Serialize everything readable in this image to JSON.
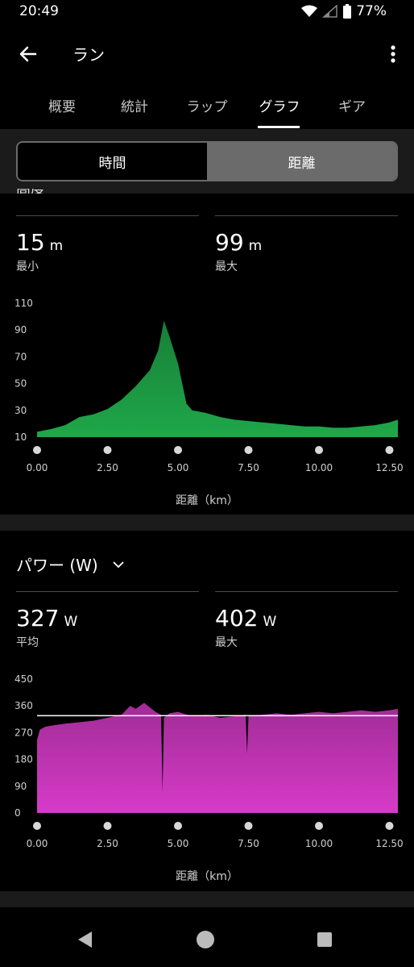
{
  "status": {
    "time": "20:49",
    "battery": "77%"
  },
  "appbar": {
    "title": "ラン"
  },
  "tabs": [
    {
      "label": "概要"
    },
    {
      "label": "統計"
    },
    {
      "label": "ラップ"
    },
    {
      "label": "グラフ"
    },
    {
      "label": "ギア"
    }
  ],
  "toggle": {
    "time_label": "時間",
    "distance_label": "距離"
  },
  "elevation": {
    "title_partial": "高度",
    "min_value": "15",
    "min_unit": "m",
    "min_label": "最小",
    "max_value": "99",
    "max_unit": "m",
    "max_label": "最大",
    "xaxis_title": "距離（km）",
    "color": "#1fa84a"
  },
  "power": {
    "title": "パワー (W)",
    "avg_value": "327",
    "avg_unit": "W",
    "avg_label": "平均",
    "max_value": "402",
    "max_unit": "W",
    "max_label": "最大",
    "xaxis_title": "距離（km）",
    "color": "#d63bc8"
  },
  "chart_data": [
    {
      "type": "area",
      "x": [
        0,
        0.5,
        1.0,
        1.5,
        2.0,
        2.5,
        3.0,
        3.5,
        4.0,
        4.3,
        4.5,
        4.7,
        5.0,
        5.3,
        5.5,
        6.0,
        6.5,
        7.0,
        7.5,
        8.0,
        8.5,
        9.0,
        9.5,
        10.0,
        10.5,
        11.0,
        11.5,
        12.0,
        12.5,
        12.8
      ],
      "y": [
        14,
        16,
        19,
        25,
        27,
        31,
        38,
        48,
        60,
        75,
        97,
        85,
        65,
        35,
        30,
        28,
        25,
        23,
        22,
        21,
        20,
        19,
        18,
        18,
        17,
        17,
        18,
        19,
        21,
        23
      ],
      "xlabel": "距離（km）",
      "ylabel": "",
      "xticks": [
        "0.00",
        "2.50",
        "5.00",
        "7.50",
        "10.00",
        "12.50"
      ],
      "yticks": [
        "10",
        "30",
        "50",
        "70",
        "90",
        "110"
      ],
      "xlim": [
        0,
        12.8
      ],
      "ylim": [
        10,
        110
      ]
    },
    {
      "type": "area",
      "x": [
        0,
        0.1,
        0.3,
        0.6,
        1.0,
        1.5,
        2.0,
        2.5,
        3.0,
        3.3,
        3.5,
        3.8,
        4.0,
        4.2,
        4.4,
        4.45,
        4.5,
        4.7,
        5.0,
        5.5,
        6.0,
        6.5,
        7.0,
        7.4,
        7.45,
        7.5,
        8.0,
        8.5,
        9.0,
        9.5,
        10.0,
        10.5,
        11.0,
        11.5,
        12.0,
        12.5,
        12.8
      ],
      "y": [
        245,
        280,
        290,
        295,
        300,
        305,
        310,
        320,
        330,
        360,
        350,
        370,
        355,
        340,
        330,
        70,
        320,
        335,
        340,
        325,
        330,
        320,
        325,
        330,
        200,
        325,
        330,
        335,
        330,
        335,
        340,
        335,
        340,
        345,
        340,
        345,
        350
      ],
      "avg_line": 327,
      "xlabel": "距離（km）",
      "ylabel": "",
      "xticks": [
        "0.00",
        "2.50",
        "5.00",
        "7.50",
        "10.00",
        "12.50"
      ],
      "yticks": [
        "0",
        "90",
        "180",
        "270",
        "360",
        "450"
      ],
      "xlim": [
        0,
        12.8
      ],
      "ylim": [
        0,
        450
      ]
    }
  ]
}
